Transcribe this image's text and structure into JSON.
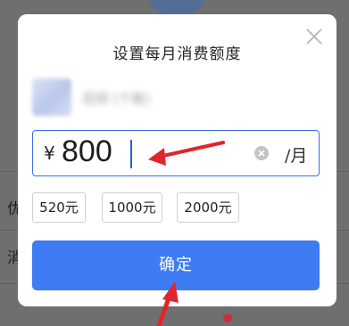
{
  "background": {
    "row1_text": "优",
    "row2_text": "消"
  },
  "dialog": {
    "title": "设置每月消费额度",
    "account_name": "花呗 (个账)",
    "amount": {
      "currency_symbol": "¥",
      "value": "800",
      "unit": "/月"
    },
    "presets": [
      "520元",
      "1000元",
      "2000元"
    ],
    "confirm_label": "确定"
  },
  "colors": {
    "accent": "#3d7cf2",
    "input_border": "#3d6de8",
    "annotation_arrow": "#e0262c"
  }
}
